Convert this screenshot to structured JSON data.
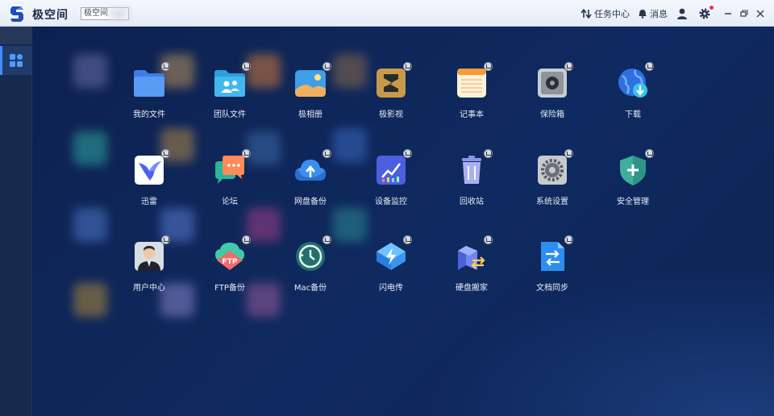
{
  "titlebar": {
    "title": "极空间",
    "device": "极空间",
    "tasks": "任务中心",
    "messages": "消息"
  },
  "apps": [
    {
      "label": "我的文件",
      "icon": "folder-icon"
    },
    {
      "label": "团队文件",
      "icon": "team-folder-icon"
    },
    {
      "label": "极相册",
      "icon": "photo-album-icon"
    },
    {
      "label": "极影视",
      "icon": "video-icon"
    },
    {
      "label": "记事本",
      "icon": "notepad-icon"
    },
    {
      "label": "保险箱",
      "icon": "safe-icon"
    },
    {
      "label": "下载",
      "icon": "download-globe-icon"
    },
    {
      "label": "迅雷",
      "icon": "xunlei-bird-icon"
    },
    {
      "label": "论坛",
      "icon": "forum-chat-icon"
    },
    {
      "label": "网盘备份",
      "icon": "cloud-upload-icon"
    },
    {
      "label": "设备监控",
      "icon": "monitor-chart-icon"
    },
    {
      "label": "回收站",
      "icon": "trash-icon"
    },
    {
      "label": "系统设置",
      "icon": "settings-gear-icon"
    },
    {
      "label": "安全管理",
      "icon": "security-shield-icon"
    },
    {
      "label": "用户中心",
      "icon": "user-avatar-icon"
    },
    {
      "label": "FTP备份",
      "icon": "ftp-cloud-icon"
    },
    {
      "label": "Mac备份",
      "icon": "time-machine-icon"
    },
    {
      "label": "闪电传",
      "icon": "lightning-transfer-icon"
    },
    {
      "label": "硬盘搬家",
      "icon": "disk-migrate-icon"
    },
    {
      "label": "文档同步",
      "icon": "doc-sync-icon"
    }
  ]
}
